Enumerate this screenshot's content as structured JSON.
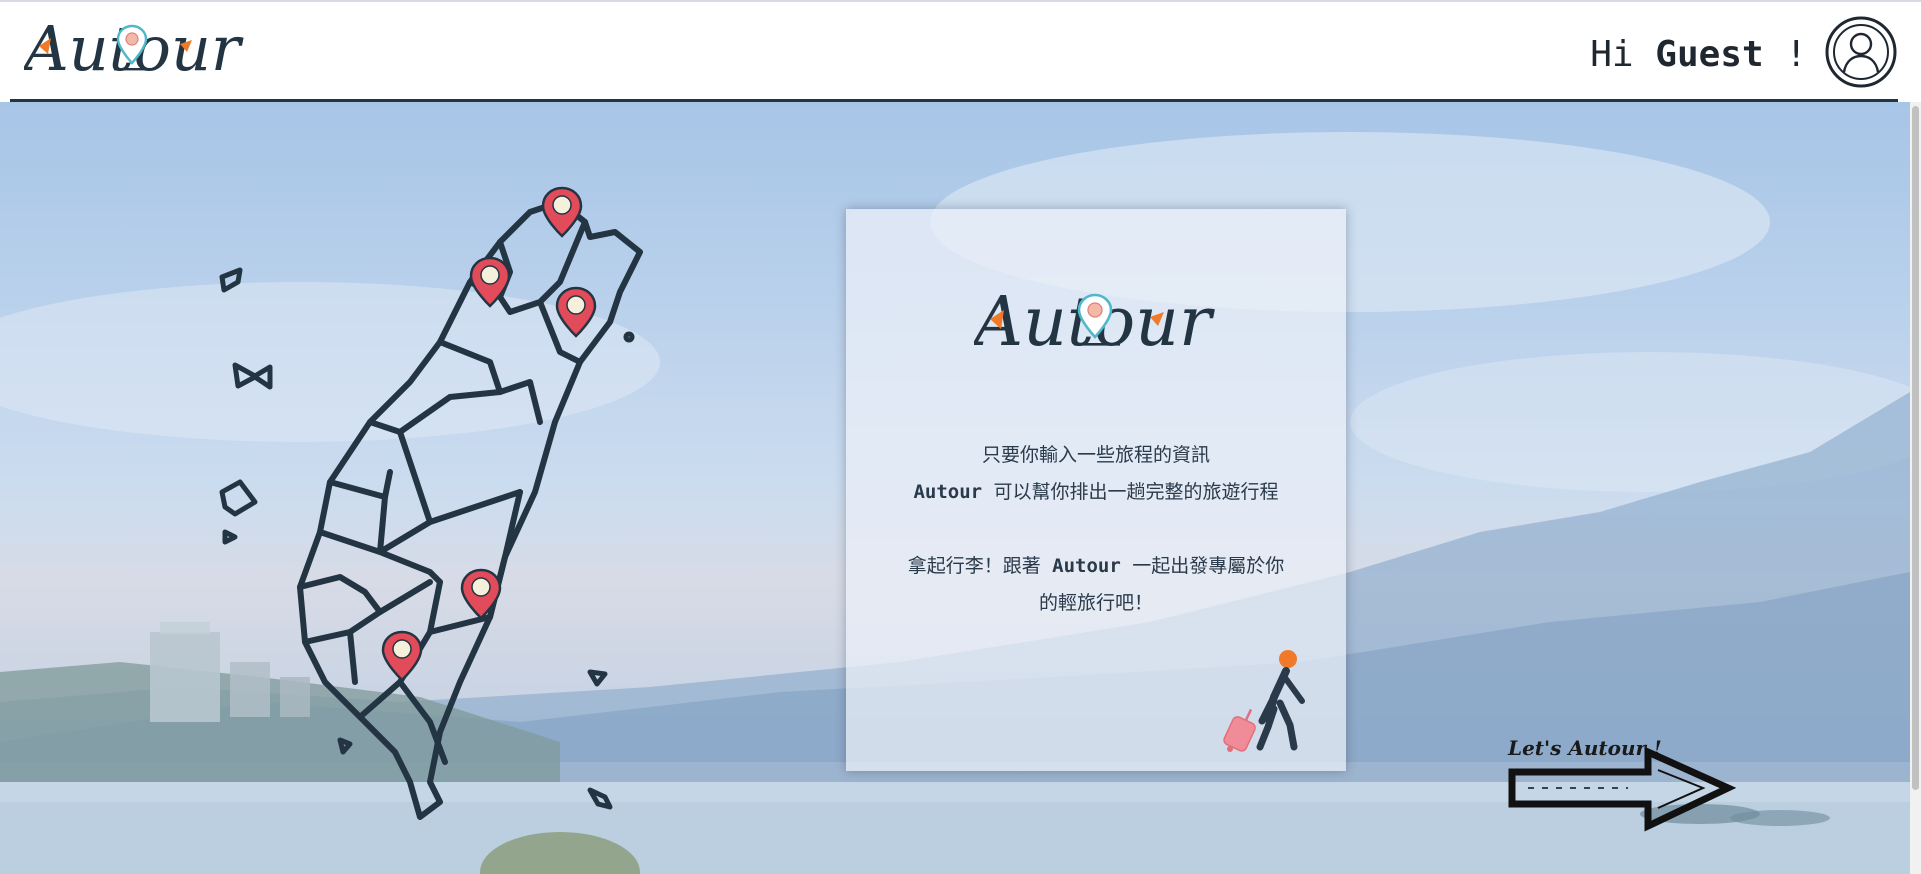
{
  "header": {
    "logo_text": "Autour",
    "greeting_prefix": "Hi ",
    "user_name": "Guest",
    "greeting_suffix": " !"
  },
  "card": {
    "logo_text": "Autour",
    "line1": "只要你輸入一些旅程的資訊",
    "line2_brand": "Autour",
    "line2_rest": " 可以幫你排出一趟完整的旅遊行程",
    "line3_a": "拿起行李！跟著 ",
    "line3_brand": "Autour",
    "line3_b": " 一起出發專屬於你",
    "line4": "的輕旅行吧！"
  },
  "cta": {
    "label": "Let's Autour !"
  },
  "colors": {
    "brand_dark": "#233442",
    "accent_orange": "#f07a2a",
    "pin_red": "#e24b5a",
    "pin_teal": "#4fb8c9"
  },
  "icons": {
    "avatar": "user-avatar-icon",
    "pin": "map-pin-icon",
    "traveler": "traveler-suitcase-icon",
    "arrow": "right-arrow-icon"
  }
}
